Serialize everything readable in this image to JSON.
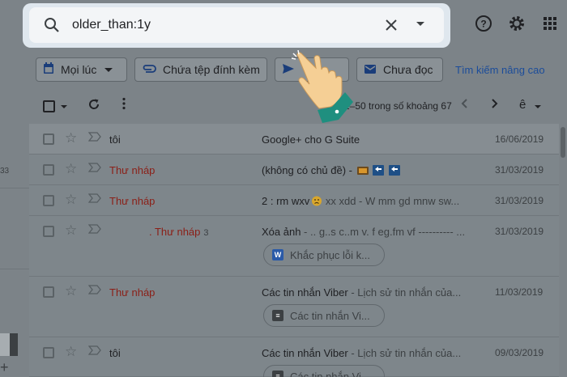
{
  "search": {
    "query": "older_than:1y",
    "icon": "search-icon",
    "clear_icon": "close-icon",
    "options_icon": "chevron-down-icon"
  },
  "header": {
    "help_icon": "help-icon",
    "settings_icon": "gear-icon",
    "apps_icon": "apps-grid-icon"
  },
  "left": {
    "count_fragment": "33",
    "plus": "+"
  },
  "filters": {
    "time": "Mọi lúc",
    "attachment": "Chứa tệp đính kèm",
    "sent": "",
    "unread": "Chưa đọc",
    "advanced": "Tìm kiếm nâng cao"
  },
  "toolbar": {
    "pager": "1–50 trong số khoảng 67",
    "language": "ê"
  },
  "emails": [
    {
      "sender": "tôi",
      "draft": false,
      "count": "",
      "subject": "Google+ cho G Suite",
      "snippet": "",
      "date": "16/06/2019",
      "attachment": ""
    },
    {
      "sender": "Thư nháp",
      "draft": true,
      "count": "",
      "subject": "(không có chủ đề) -",
      "snippet": "",
      "date": "31/03/2019",
      "attachment": ""
    },
    {
      "sender": "Thư nháp",
      "draft": true,
      "count": "",
      "subject": "2 : rm wxv",
      "snippet": " xx xdd - W mm gd mnw sw...",
      "date": "31/03/2019",
      "attachment": ""
    },
    {
      "sender": ". Thư nháp",
      "draft": true,
      "count": "3",
      "subject": "Xóa ảnh",
      "snippet": " - .. g..s c..m v. f eg.fm vf ---------- ...",
      "date": "31/03/2019",
      "attachment": "Khắc phục lỗi k..."
    },
    {
      "sender": "Thư nháp",
      "draft": true,
      "count": "",
      "subject": "Các tin nhắn Viber",
      "snippet": " - Lịch sử tin nhắn của...",
      "date": "11/03/2019",
      "attachment": "Các tin nhắn Vi..."
    },
    {
      "sender": "tôi",
      "draft": false,
      "count": "",
      "subject": "Các tin nhắn Viber",
      "snippet": " - Lịch sử tin nhắn của...",
      "date": "09/03/2019",
      "attachment": "Các tin nhắn Vi..."
    }
  ],
  "colors": {
    "overlay": "#7c8388",
    "search_bg": "#f3f5f7",
    "draft_red": "#8b1f17",
    "link_blue": "#1b4c9a",
    "hand_skin": "#f5cf95",
    "hand_cuff": "#1f8f7f"
  }
}
